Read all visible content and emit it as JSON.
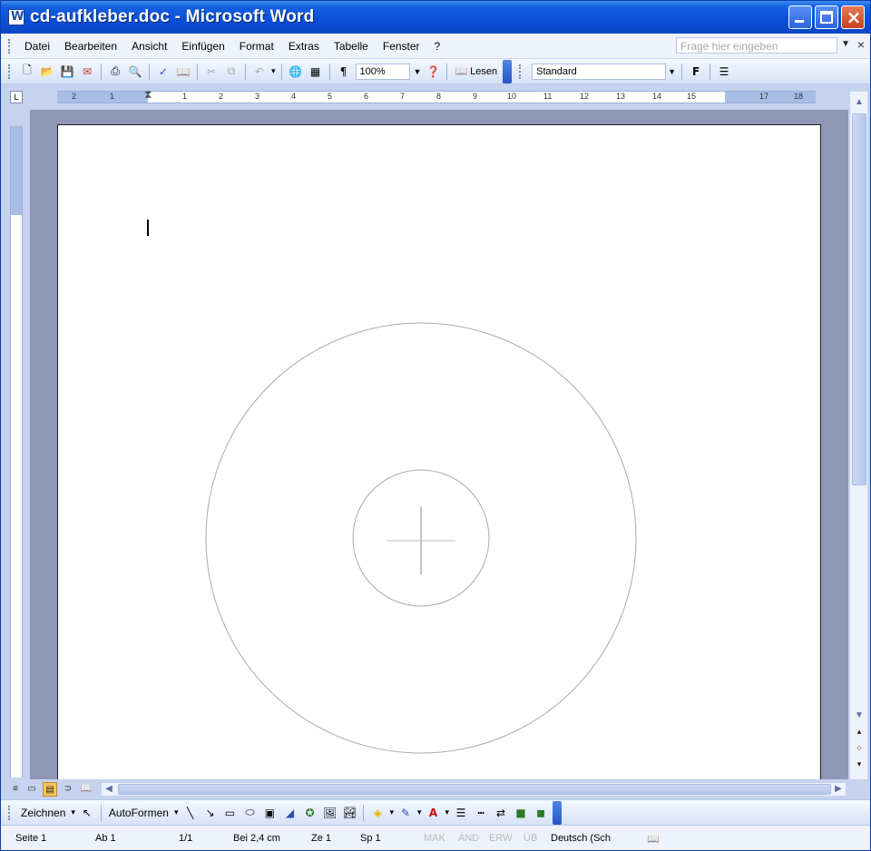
{
  "window": {
    "title": "cd-aufkleber.doc - Microsoft Word"
  },
  "menubar": {
    "items": [
      "Datei",
      "Bearbeiten",
      "Ansicht",
      "Einfügen",
      "Format",
      "Extras",
      "Tabelle",
      "Fenster",
      "?"
    ],
    "ask_placeholder": "Frage hier eingeben"
  },
  "toolbar": {
    "zoom": "100%",
    "lesen_label": "Lesen",
    "style": "Standard",
    "bold_label": "F"
  },
  "ruler": {
    "numbers": [
      "2",
      "1",
      "1",
      "2",
      "3",
      "4",
      "5",
      "6",
      "7",
      "8",
      "9",
      "10",
      "11",
      "12",
      "13",
      "14",
      "15",
      "17",
      "18"
    ]
  },
  "drawbar": {
    "zeichnen_label": "Zeichnen",
    "autoformen_label": "AutoFormen"
  },
  "statusbar": {
    "seite": "Seite 1",
    "ab": "Ab 1",
    "pages": "1/1",
    "bei": "Bei 2,4 cm",
    "ze": "Ze 1",
    "sp": "Sp 1",
    "mak": "MAK",
    "aend": "ÄND",
    "erw": "ERW",
    "ub": "ÜB",
    "language": "Deutsch (Sch"
  },
  "colors": {
    "titlebar": "#0a4fd8",
    "doc_bg": "#8e97b4",
    "accent": "#f7c35b"
  }
}
